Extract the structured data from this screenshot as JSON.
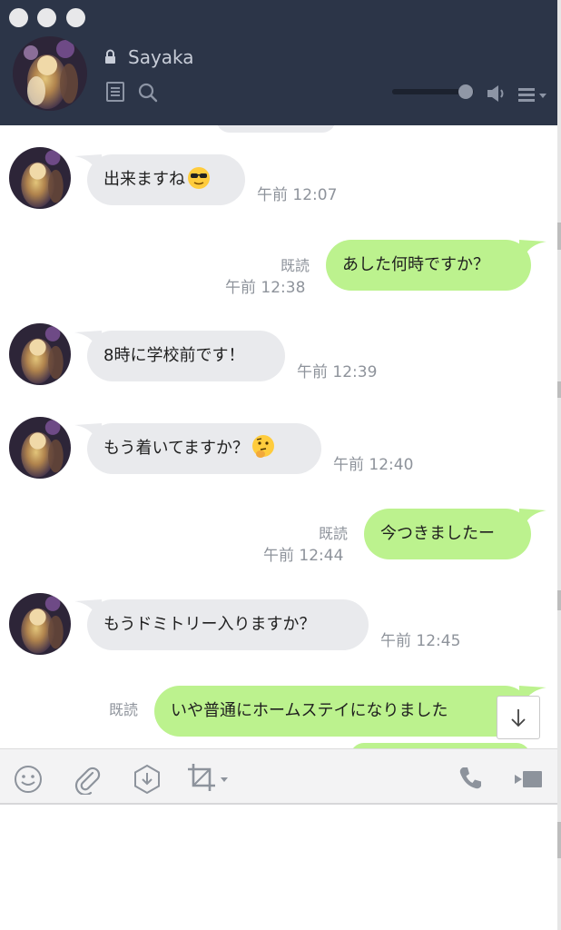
{
  "header": {
    "contact_name": "Sayaka",
    "icons": [
      "lock-icon",
      "notes-icon",
      "search-icon",
      "volume-slider",
      "speaker-icon",
      "menu-icon"
    ],
    "volume_level": 0.9
  },
  "messages": [
    {
      "direction": "in",
      "text": "出来ますね",
      "emoji": "sunglasses-face",
      "time": "午前 12:07"
    },
    {
      "direction": "out",
      "text": "あした何時ですか？",
      "read": "既読",
      "time": "午前 12:38"
    },
    {
      "direction": "in",
      "text": "8時に学校前です！",
      "time": "午前 12:39"
    },
    {
      "direction": "in",
      "text": "もう着いてますか？",
      "emoji": "thinking-face",
      "time": "午前 12:40"
    },
    {
      "direction": "out",
      "text": "今つきましたー",
      "read": "既読",
      "time": "午前 12:44"
    },
    {
      "direction": "in",
      "text": "もうドミトリー入りますか？",
      "time": "午前 12:45"
    },
    {
      "direction": "out",
      "text": "いや普通にホームステイになりました",
      "read": "既読"
    }
  ],
  "toolbar": {
    "icons": [
      "emoji-icon",
      "attachment-icon",
      "download-icon",
      "crop-icon",
      "phone-icon",
      "video-icon"
    ]
  },
  "colors": {
    "header_bg": "#2c3548",
    "incoming_bubble": "#e9eaed",
    "outgoing_bubble": "#bcf28e",
    "meta_text": "#8e939b"
  }
}
